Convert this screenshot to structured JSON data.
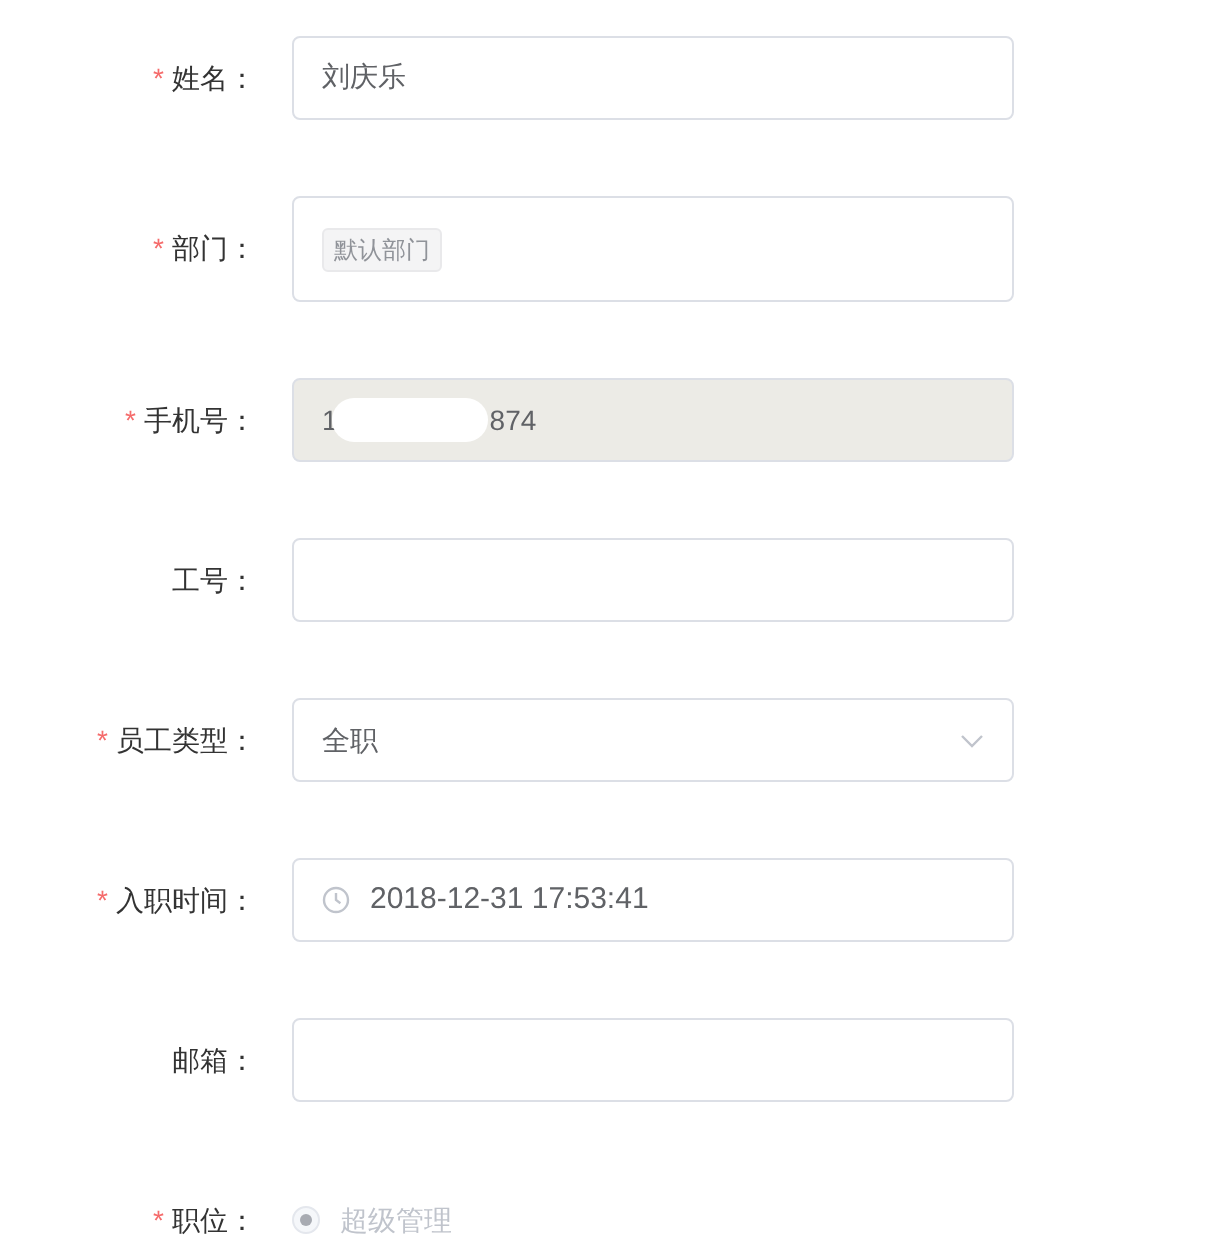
{
  "fields": [
    {
      "kind": "text",
      "label": "姓名：",
      "required_mark": "*",
      "value": "刘庆乐"
    },
    {
      "kind": "tags",
      "label": "部门：",
      "required_mark": "*",
      "tags": [
        "默认部门"
      ]
    },
    {
      "kind": "redacted",
      "label": "手机号：",
      "required_mark": "*",
      "value_start": "1",
      "value_end": "874",
      "disabled": true
    },
    {
      "kind": "text",
      "label": "工号："
    },
    {
      "kind": "select",
      "label": "员工类型：",
      "required_mark": "*",
      "value": "全职"
    },
    {
      "kind": "datetime",
      "label": "入职时间：",
      "required_mark": "*",
      "value": "2018-12-31 17:53:41"
    },
    {
      "kind": "text",
      "label": "邮箱："
    },
    {
      "kind": "radio",
      "label": "职位：",
      "required_mark": "*",
      "options": [
        {
          "label": "超级管理",
          "selected": true,
          "disabled": true
        }
      ]
    }
  ]
}
